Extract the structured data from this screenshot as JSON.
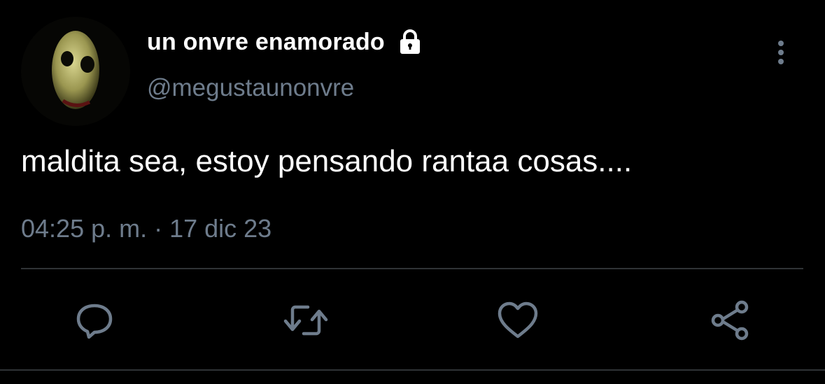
{
  "tweet": {
    "display_name": "un onvre enamorado",
    "handle": "@megustaunonvre",
    "text": "maldita sea, estoy pensando rantaa cosas....",
    "timestamp": "04:25 p. m. · 17 dic 23",
    "protected": true
  },
  "icons": {
    "lock": "lock-icon",
    "more": "more-vertical-icon",
    "reply": "reply-icon",
    "retweet": "retweet-icon",
    "like": "heart-icon",
    "share": "share-icon"
  },
  "colors": {
    "background": "#000000",
    "primary_text": "#ffffff",
    "secondary_text": "#6e7c8c",
    "divider": "#2f3336"
  }
}
